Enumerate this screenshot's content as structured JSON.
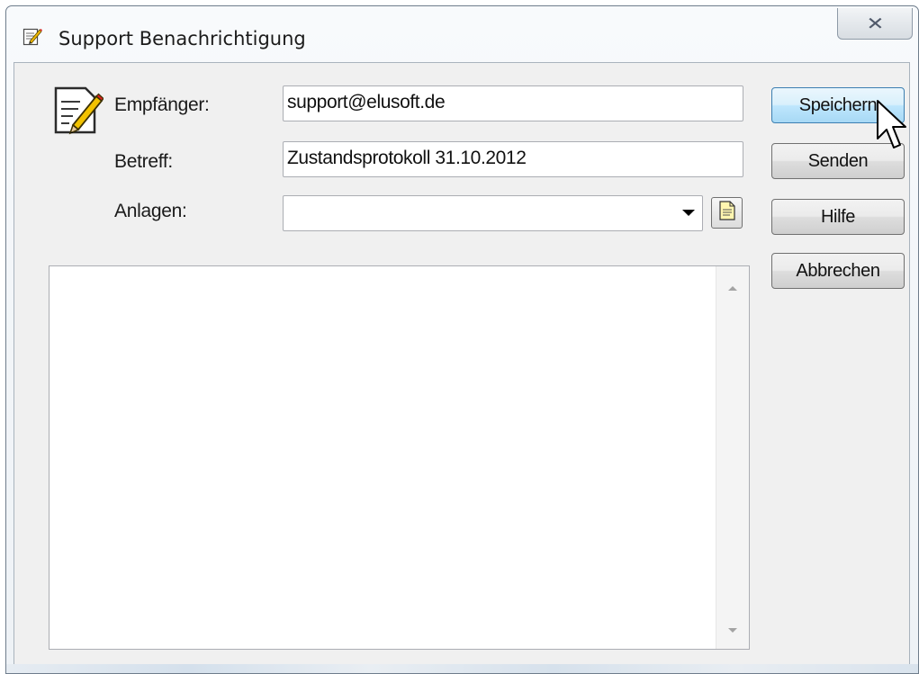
{
  "window": {
    "title": "Support Benachrichtigung",
    "title_icon": "notepad-pencil-icon",
    "close_symbol": "✕"
  },
  "form": {
    "recipient_label": "Empfänger:",
    "recipient_value": "support@elusoft.de",
    "subject_label": "Betreff:",
    "subject_value": "Zustandsprotokoll 31.10.2012",
    "attachments_label": "Anlagen:",
    "attachments_value": "",
    "attachments_button_icon": "document-icon",
    "header_icon": "notepad-pencil-icon",
    "message_body": ""
  },
  "buttons": {
    "save": "Speichern",
    "send": "Senden",
    "help": "Hilfe",
    "cancel": "Abbrechen"
  }
}
